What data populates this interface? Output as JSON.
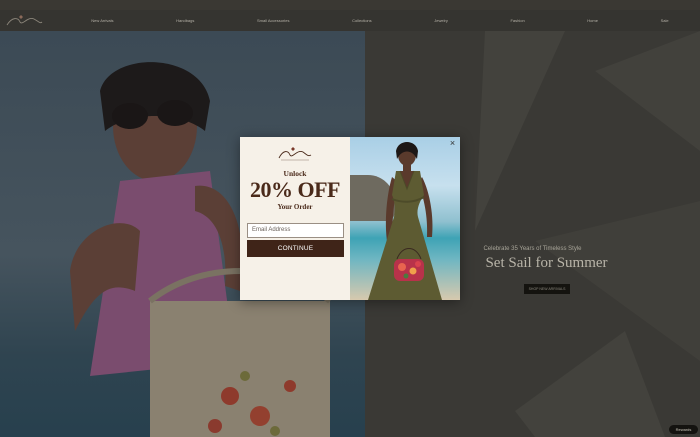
{
  "announcement": "",
  "nav": {
    "items": [
      "New Arrivals",
      "Handbags",
      "Small Accessories",
      "Collections",
      "Jewelry",
      "Fashion",
      "Home",
      "Sale"
    ]
  },
  "hero": {
    "subtitle": "Celebrate 35 Years of Timeless Style",
    "title": "Set Sail for Summer",
    "button_label": "SHOP NEW ARRIVALS"
  },
  "rewards_label": "Rewards",
  "modal": {
    "unlock": "Unlock",
    "offer": "20% OFF",
    "your_order": "Your Order",
    "email_placeholder": "Email Address",
    "continue_label": "CONTINUE",
    "close_symbol": "×"
  },
  "colors": {
    "modal_bg": "#f6f1e8",
    "brand_brown": "#3f2418",
    "heading_brown": "#4a2a1a"
  },
  "icons": [
    "close-icon",
    "brand-logo"
  ]
}
